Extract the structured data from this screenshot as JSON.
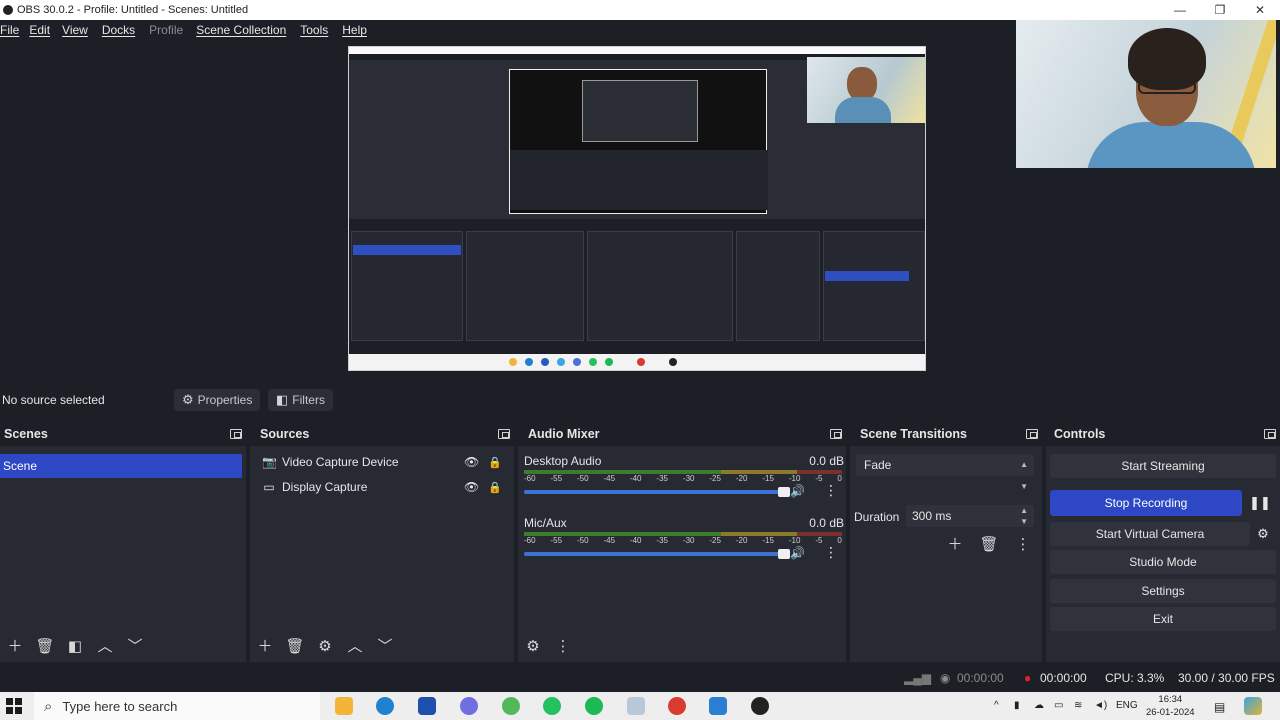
{
  "window": {
    "title": "OBS 30.0.2 - Profile: Untitled - Scenes: Untitled",
    "controls": [
      "—",
      "❐",
      "✕"
    ]
  },
  "menu": [
    "File",
    "Edit",
    "View",
    "Docks",
    "Profile",
    "Scene Collection",
    "Tools",
    "Help"
  ],
  "source_toolbar": {
    "status": "No source selected",
    "properties_label": "Properties",
    "filters_label": "Filters"
  },
  "scenes": {
    "title": "Scenes",
    "items": [
      "Scene"
    ]
  },
  "sources": {
    "title": "Sources",
    "items": [
      {
        "label": "Video Capture Device",
        "icon": "camera-icon"
      },
      {
        "label": "Display Capture",
        "icon": "monitor-icon"
      }
    ]
  },
  "audio_mixer": {
    "title": "Audio Mixer",
    "ticks": [
      "-60",
      "-55",
      "-50",
      "-45",
      "-40",
      "-35",
      "-30",
      "-25",
      "-20",
      "-15",
      "-10",
      "-5",
      "0"
    ],
    "channels": [
      {
        "name": "Desktop Audio",
        "db": "0.0 dB"
      },
      {
        "name": "Mic/Aux",
        "db": "0.0 dB"
      }
    ]
  },
  "scene_transitions": {
    "title": "Scene Transitions",
    "transition": "Fade",
    "duration_label": "Duration",
    "duration_value": "300 ms"
  },
  "controls": {
    "title": "Controls",
    "start_streaming": "Start Streaming",
    "stop_recording": "Stop Recording",
    "start_virtual_camera": "Start Virtual Camera",
    "studio_mode": "Studio Mode",
    "settings": "Settings",
    "exit": "Exit"
  },
  "status": {
    "stream_time": "00:00:00",
    "rec_time": "00:00:00",
    "cpu": "CPU: 3.3%",
    "fps": "30.00 / 30.00 FPS"
  },
  "taskbar": {
    "search_placeholder": "Type here to search",
    "language": "ENG",
    "time": "16:34",
    "date": "26-01-2024"
  },
  "colors": {
    "accent": "#2d47c5",
    "dock_bg": "#272a33",
    "window_bg": "#1d1f26",
    "rec_indicator": "#e02424"
  }
}
